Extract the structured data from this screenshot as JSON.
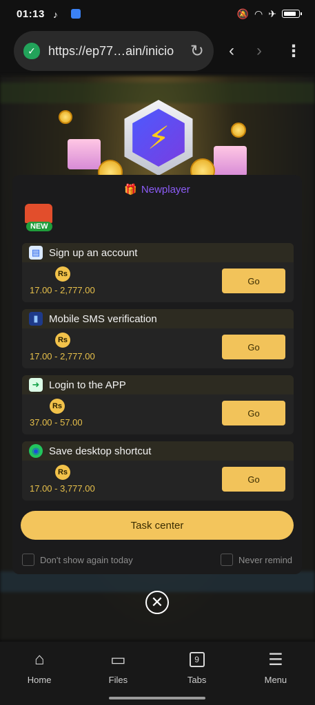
{
  "status_bar": {
    "time": "01:13"
  },
  "browser": {
    "url": "https://ep77…ain/inicio",
    "icons": [
      "shield-icon",
      "reload-icon",
      "back-icon",
      "forward-icon",
      "more-icon"
    ]
  },
  "modal": {
    "title": "Newplayer",
    "new_tag": "NEW",
    "tasks": [
      {
        "name": "Sign up an account",
        "currency": "Rs",
        "range": "17.00 - 2,777.00",
        "button": "Go"
      },
      {
        "name": "Mobile SMS verification",
        "currency": "Rs",
        "range": "17.00 - 2,777.00",
        "button": "Go"
      },
      {
        "name": "Login to the APP",
        "currency": "Rs",
        "range": "37.00 - 57.00",
        "button": "Go"
      },
      {
        "name": "Save desktop shortcut",
        "currency": "Rs",
        "range": "17.00 - 3,777.00",
        "button": "Go"
      }
    ],
    "task_center": "Task center",
    "dont_show": "Don't show again today",
    "never_remind": "Never remind"
  },
  "bottom_nav": {
    "home": "Home",
    "files": "Files",
    "tabs": "Tabs",
    "tabs_count": "9",
    "menu": "Menu"
  },
  "colors": {
    "accent": "#f3c55c",
    "title_purple": "#8b5cf6",
    "range_gold": "#e8c14b"
  }
}
